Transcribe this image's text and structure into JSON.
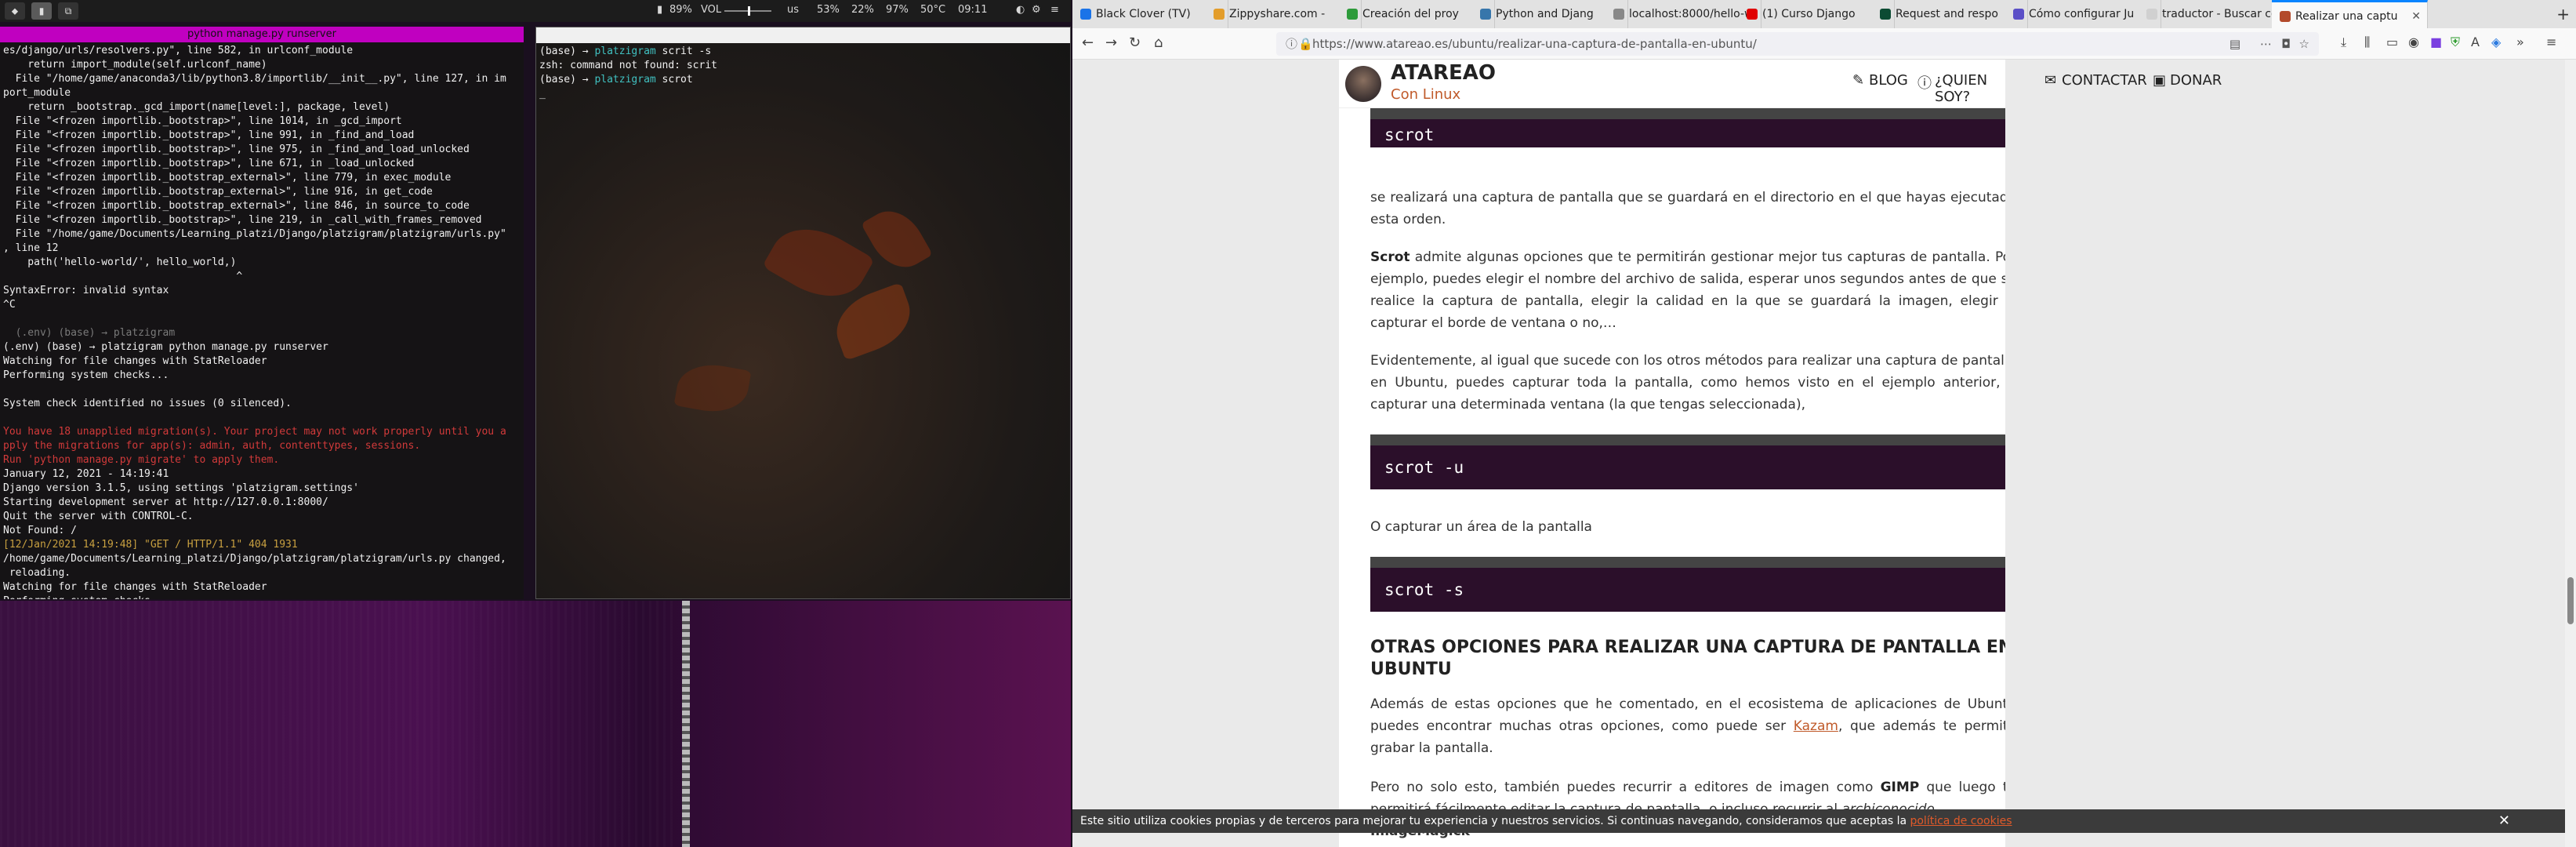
{
  "statusbar": {
    "workspaces": [
      "1",
      "2",
      "3"
    ],
    "battery": "89%",
    "volume_label": "VOL",
    "keyboard": "us",
    "mem": "53%",
    "cpu": "22%",
    "disk": "97%",
    "temp": "50°C",
    "time": "09:11"
  },
  "term_left": {
    "title": "python manage.py runserver",
    "lines": [
      {
        "t": "es/django/urls/resolvers.py\", line 582, in urlconf_module",
        "c": "wht"
      },
      {
        "t": "    return import_module(self.urlconf_name)",
        "c": "wht"
      },
      {
        "t": "  File \"/home/game/anaconda3/lib/python3.8/importlib/__init__.py\", line 127, in im",
        "c": "wht"
      },
      {
        "t": "port_module",
        "c": "wht"
      },
      {
        "t": "    return _bootstrap._gcd_import(name[level:], package, level)",
        "c": "wht"
      },
      {
        "t": "  File \"<frozen importlib._bootstrap>\", line 1014, in _gcd_import",
        "c": "wht"
      },
      {
        "t": "  File \"<frozen importlib._bootstrap>\", line 991, in _find_and_load",
        "c": "wht"
      },
      {
        "t": "  File \"<frozen importlib._bootstrap>\", line 975, in _find_and_load_unlocked",
        "c": "wht"
      },
      {
        "t": "  File \"<frozen importlib._bootstrap>\", line 671, in _load_unlocked",
        "c": "wht"
      },
      {
        "t": "  File \"<frozen importlib._bootstrap_external>\", line 779, in exec_module",
        "c": "wht"
      },
      {
        "t": "  File \"<frozen importlib._bootstrap_external>\", line 916, in get_code",
        "c": "wht"
      },
      {
        "t": "  File \"<frozen importlib._bootstrap_external>\", line 846, in source_to_code",
        "c": "wht"
      },
      {
        "t": "  File \"<frozen importlib._bootstrap>\", line 219, in _call_with_frames_removed",
        "c": "wht"
      },
      {
        "t": "  File \"/home/game/Documents/Learning_platzi/Django/platzigram/platzigram/urls.py\"",
        "c": "wht"
      },
      {
        "t": ", line 12",
        "c": "wht"
      },
      {
        "t": "    path('hello-world/', hello_world,)",
        "c": "wht"
      },
      {
        "t": "                                      ^",
        "c": "wht"
      },
      {
        "t": "SyntaxError: invalid syntax",
        "c": "wht"
      },
      {
        "t": "^C",
        "c": "wht"
      },
      {
        "t": "",
        "c": "wht"
      },
      {
        "t": "  (.env) (base) → platzigram",
        "c": "dim"
      },
      {
        "t": "(.env) (base) → platzigram python manage.py runserver",
        "c": "wht"
      },
      {
        "t": "Watching for file changes with StatReloader",
        "c": "wht"
      },
      {
        "t": "Performing system checks...",
        "c": "wht"
      },
      {
        "t": "",
        "c": "wht"
      },
      {
        "t": "System check identified no issues (0 silenced).",
        "c": "wht"
      },
      {
        "t": "",
        "c": "wht"
      },
      {
        "t": "You have 18 unapplied migration(s). Your project may not work properly until you a",
        "c": "red"
      },
      {
        "t": "pply the migrations for app(s): admin, auth, contenttypes, sessions.",
        "c": "red"
      },
      {
        "t": "Run 'python manage.py migrate' to apply them.",
        "c": "red"
      },
      {
        "t": "January 12, 2021 - 14:19:41",
        "c": "wht"
      },
      {
        "t": "Django version 3.1.5, using settings 'platzigram.settings'",
        "c": "wht"
      },
      {
        "t": "Starting development server at http://127.0.0.1:8000/",
        "c": "wht"
      },
      {
        "t": "Quit the server with CONTROL-C.",
        "c": "wht"
      },
      {
        "t": "Not Found: /",
        "c": "wht"
      },
      {
        "t": "[12/Jan/2021 14:19:48] \"GET / HTTP/1.1\" 404 1931",
        "c": "yel"
      },
      {
        "t": "/home/game/Documents/Learning_platzi/Django/platzigram/platzigram/urls.py changed,",
        "c": "wht"
      },
      {
        "t": " reloading.",
        "c": "wht"
      },
      {
        "t": "Watching for file changes with StatReloader",
        "c": "wht"
      },
      {
        "t": "Performing system checks...",
        "c": "wht"
      }
    ]
  },
  "term_right": {
    "lines": [
      {
        "prompt": "(base) → ",
        "dir": "platzigram",
        "cmd": " scrit -s"
      },
      {
        "plain": "zsh: command not found: scrit"
      },
      {
        "prompt": "(base) → ",
        "dir": "platzigram",
        "cmd": " scrot"
      },
      {
        "plain": "_"
      }
    ]
  },
  "browser": {
    "tabs": [
      {
        "label": "Black Clover (TV)",
        "color": "#1a73e8"
      },
      {
        "label": "Zippyshare.com -",
        "color": "#e39d2b"
      },
      {
        "label": "Creación del proy",
        "color": "#2d9b3a"
      },
      {
        "label": "Python and Djang",
        "color": "#3776ab"
      },
      {
        "label": "localhost:8000/hello-w",
        "color": "#888888"
      },
      {
        "label": "(1) Curso Django",
        "color": "#e00000"
      },
      {
        "label": "Request and respo",
        "color": "#0c4b33"
      },
      {
        "label": "Cómo configurar Ju",
        "color": "#5b4fc7"
      },
      {
        "label": "traductor - Buscar con",
        "color": "#d0d0d0"
      },
      {
        "label": "Realizar una captu",
        "color": "#b34a2b"
      }
    ],
    "url": "https://www.atareao.es/ubuntu/realizar-una-captura-de-pantalla-en-ubuntu/",
    "site": {
      "name": "ATAREAO",
      "tagline": "Con Linux",
      "nav": [
        "BLOG",
        "¿QUIEN SOY?",
        "CONTACTAR",
        "DONAR"
      ]
    },
    "article": {
      "code1": "scrot",
      "p1": "se realizará una captura de pantalla que se guardará en el directorio en el que hayas ejecutado esta orden.",
      "p2_bold": "Scrot",
      "p2": " admite algunas opciones que te permitirán gestionar mejor tus capturas de pantalla. Por ejemplo, puedes elegir el nombre del archivo de salida, esperar unos segundos antes de que se realice la captura de pantalla, elegir la calidad en la que se guardará la imagen, elegir si capturar el borde de ventana o no,…",
      "p3": "Evidentemente, al igual que sucede con los otros métodos para realizar una captura de pantalla en Ubuntu, puedes capturar toda la pantalla, como hemos visto en el ejemplo anterior, o capturar una determinada ventana (la que tengas seleccionada),",
      "code2": "scrot -u",
      "p4": "O capturar un área de la pantalla",
      "code3": "scrot -s",
      "h2": "OTRAS OPCIONES PARA REALIZAR UNA CAPTURA DE PANTALLA EN UBUNTU",
      "p5a": "Además de estas opciones que he comentado, en el ecosistema de aplicaciones de Ubuntu puedes encontrar muchas otras opciones, como puede ser ",
      "p5link": "Kazam",
      "p5b": ", que además te permite grabar la pantalla.",
      "p6a": "Pero no solo esto, también puedes recurrir a editores de imagen como ",
      "p6bold": "GIMP",
      "p6b": " que luego te permitirá fácilmente editar la captura de pantalla, o incluso recurrir al ",
      "p6i": "archiconocido",
      "p7": "ImageMagick"
    },
    "cookie": {
      "text": "Este sitio utiliza cookies propias y de terceros para mejorar tu experiencia y nuestros servicios. Si continuas navegando, consideramos que aceptas la ",
      "link": "política de cookies"
    }
  }
}
